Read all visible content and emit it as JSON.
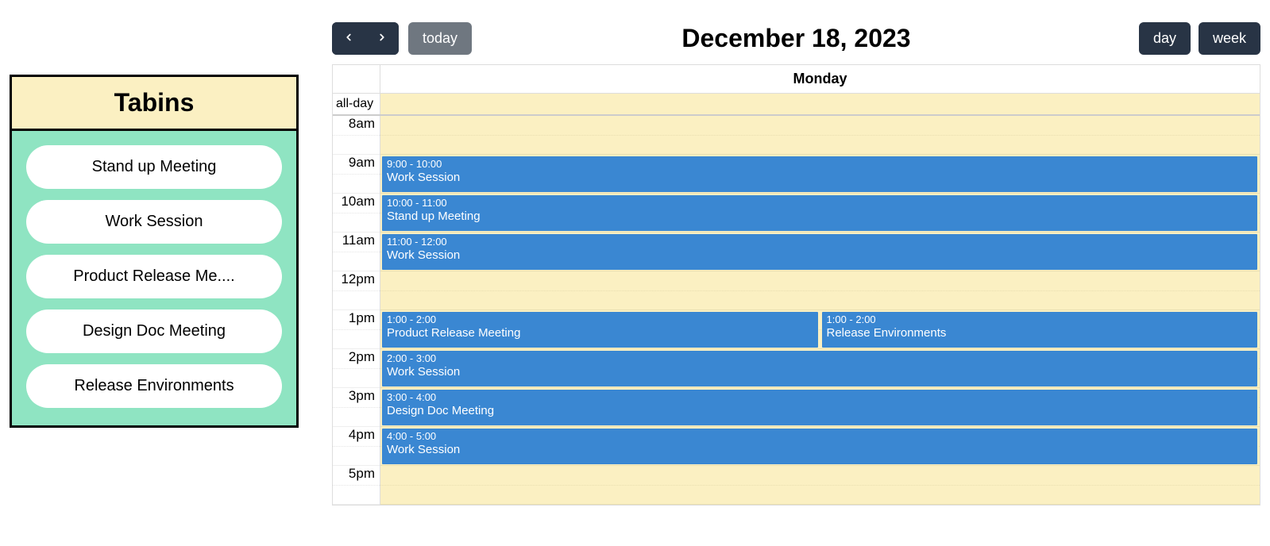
{
  "sidebar": {
    "title": "Tabins",
    "items": [
      {
        "label": "Stand up Meeting"
      },
      {
        "label": "Work Session"
      },
      {
        "label": "Product Release Me...."
      },
      {
        "label": "Design Doc Meeting"
      },
      {
        "label": "Release Environments"
      }
    ]
  },
  "toolbar": {
    "today_label": "today",
    "title": "December 18, 2023",
    "day_label": "day",
    "week_label": "week"
  },
  "calendar": {
    "day_header": "Monday",
    "allday_label": "all-day",
    "hours": [
      "8am",
      "9am",
      "10am",
      "11am",
      "12pm",
      "1pm",
      "2pm",
      "3pm",
      "4pm",
      "5pm"
    ],
    "events": [
      {
        "time": "9:00 - 10:00",
        "title": "Work Session",
        "startHour": 9,
        "col": 0,
        "cols": 1
      },
      {
        "time": "10:00 - 11:00",
        "title": "Stand up Meeting",
        "startHour": 10,
        "col": 0,
        "cols": 1
      },
      {
        "time": "11:00 - 12:00",
        "title": "Work Session",
        "startHour": 11,
        "col": 0,
        "cols": 1
      },
      {
        "time": "1:00 - 2:00",
        "title": "Product Release Meeting",
        "startHour": 13,
        "col": 0,
        "cols": 2
      },
      {
        "time": "1:00 - 2:00",
        "title": "Release Environments",
        "startHour": 13,
        "col": 1,
        "cols": 2
      },
      {
        "time": "2:00 - 3:00",
        "title": "Work Session",
        "startHour": 14,
        "col": 0,
        "cols": 1
      },
      {
        "time": "3:00 - 4:00",
        "title": "Design Doc Meeting",
        "startHour": 15,
        "col": 0,
        "cols": 1
      },
      {
        "time": "4:00 - 5:00",
        "title": "Work Session",
        "startHour": 16,
        "col": 0,
        "cols": 1
      }
    ]
  }
}
